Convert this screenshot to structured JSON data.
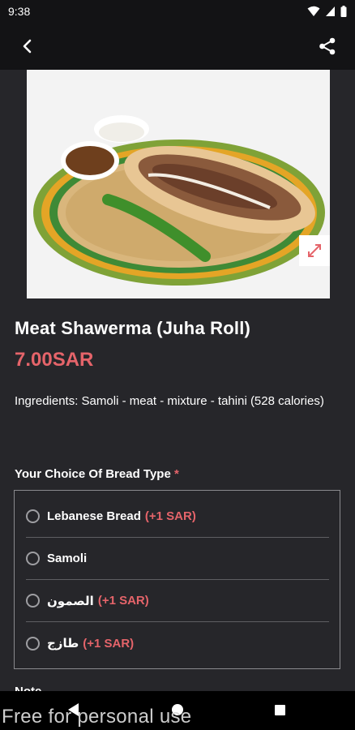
{
  "status_bar": {
    "time": "9:38",
    "icons": [
      "wifi-icon",
      "signal-icon",
      "battery-icon"
    ]
  },
  "app_bar": {
    "back_icon": "back-arrow-icon",
    "share_icon": "share-icon"
  },
  "product": {
    "image_alt": "shawerma-photo",
    "expand_icon": "expand-icon",
    "title": "Meat Shawerma (Juha Roll)",
    "price": "7.00SAR",
    "ingredients": "Ingredients: Samoli - meat - mixture - tahini (528 calories)"
  },
  "bread_choice": {
    "label": "Your Choice Of Bread Type",
    "required_mark": "*",
    "options": [
      {
        "label": "Lebanese Bread",
        "extra": "(+1 SAR)"
      },
      {
        "label": "Samoli",
        "extra": ""
      },
      {
        "label": "الصمون",
        "extra": "(+1 SAR)"
      },
      {
        "label": "طازج",
        "extra": "(+1 SAR)"
      }
    ]
  },
  "note_label_partial": "Note",
  "watermark": "Free for personal use",
  "colors": {
    "background": "#26262a",
    "bar": "#131315",
    "accent": "#e5646a"
  }
}
